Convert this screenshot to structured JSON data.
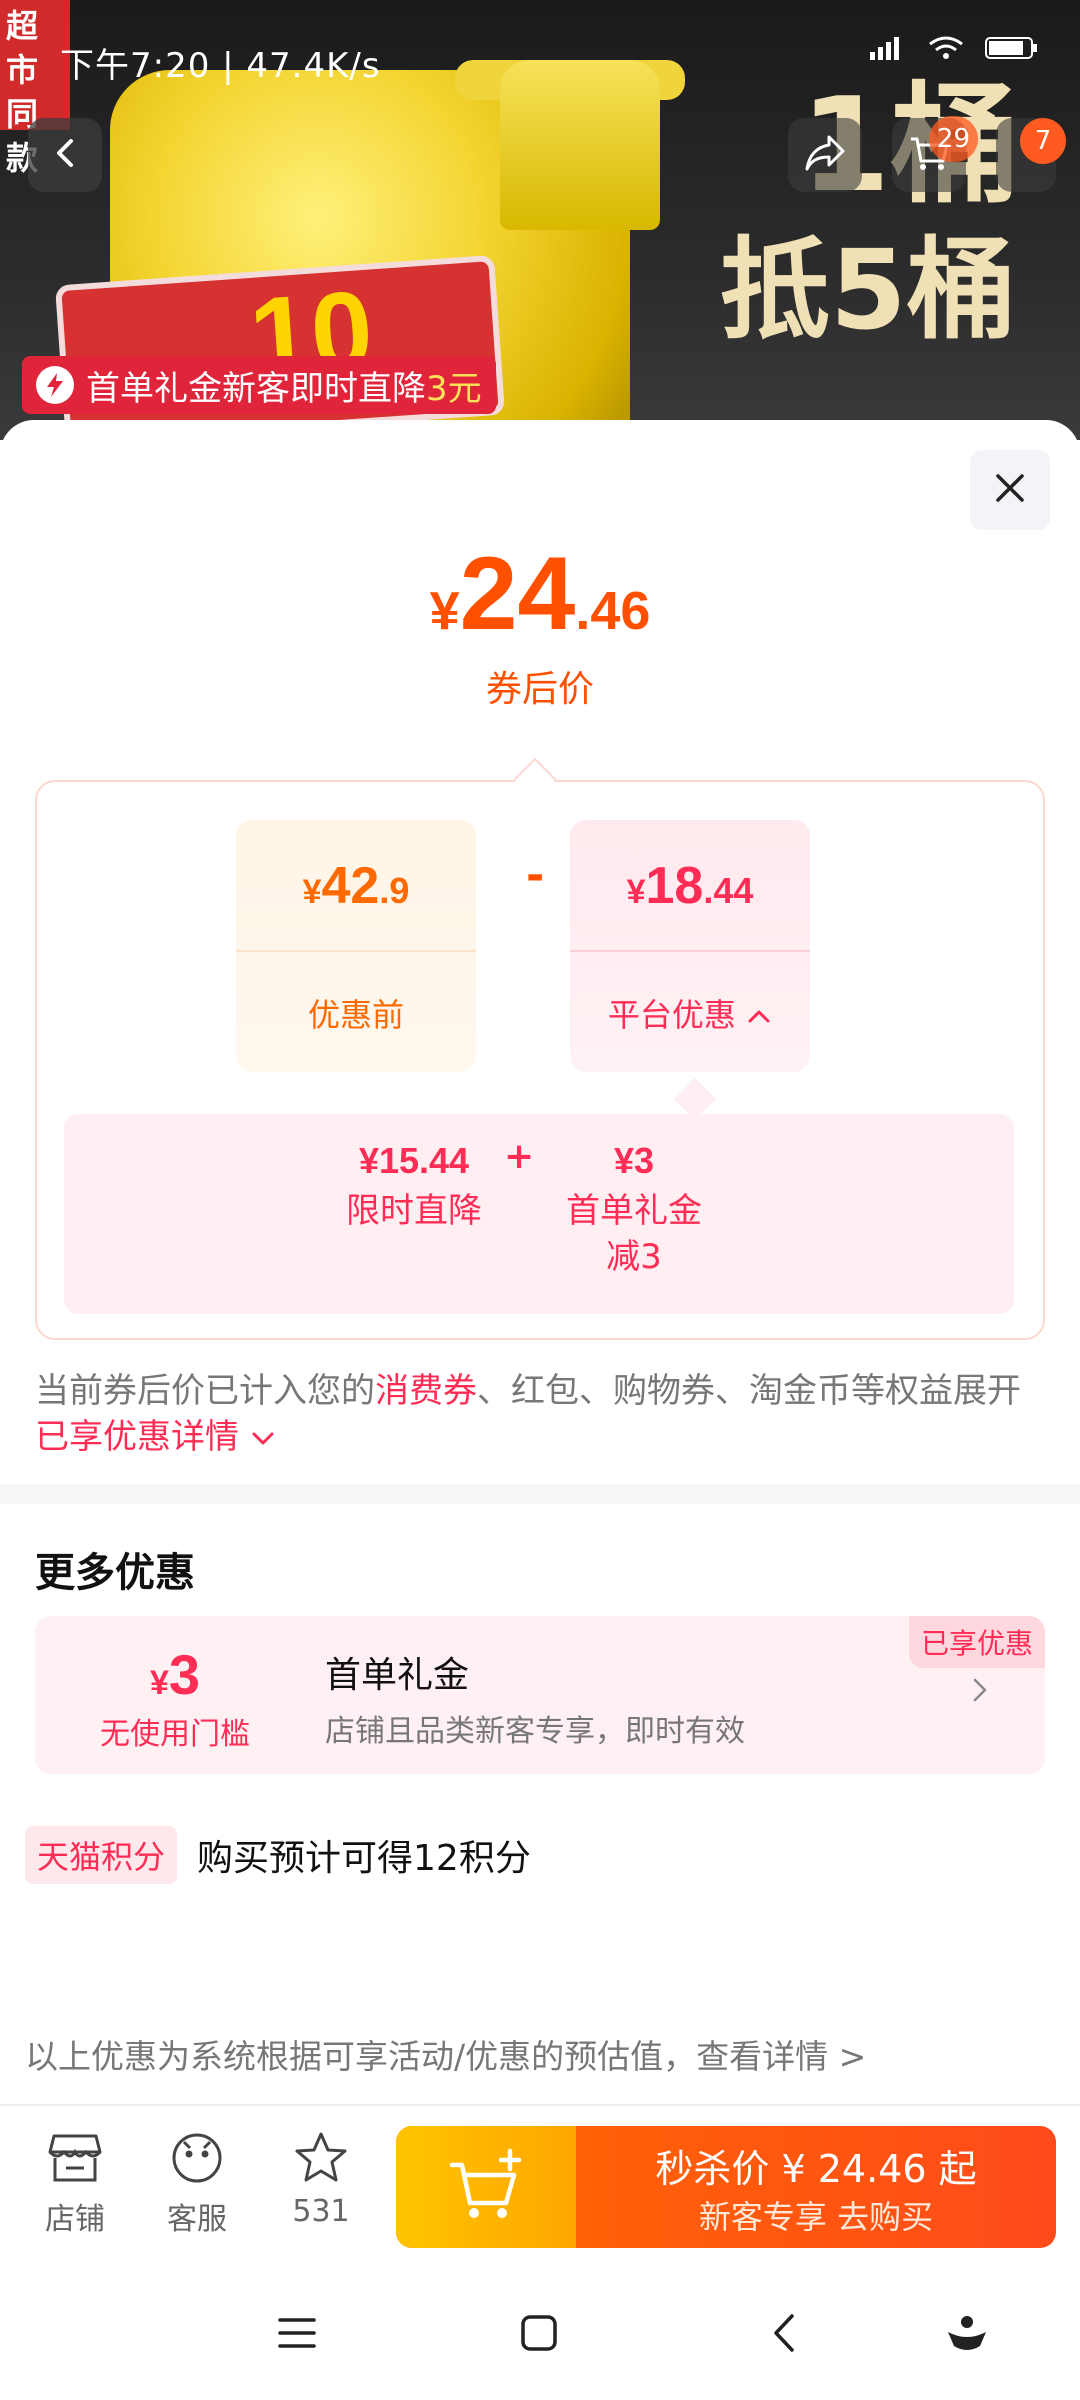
{
  "status_bar": {
    "time_speed": "下午7:20 | 47.4K/s"
  },
  "hero": {
    "supermarket_badge": "超市同款",
    "headline_1": "1桶",
    "headline_2": "抵5桶",
    "label_number": "10",
    "cart_count": "29",
    "more_count": "7",
    "first_order_banner": {
      "prefix": "首单礼金新客即时直降",
      "amount": "3元"
    }
  },
  "price": {
    "yen": "¥",
    "int": "24",
    "dec": ".46",
    "caption": "券后价"
  },
  "breakdown": {
    "before": {
      "yen": "¥",
      "int": "42",
      "dec": ".9",
      "label": "优惠前"
    },
    "operator": "-",
    "platform": {
      "yen": "¥",
      "int": "18",
      "dec": ".44",
      "label": "平台优惠"
    },
    "sub_items": [
      {
        "value": "¥15.44",
        "label": "限时直降"
      },
      {
        "value": "¥3",
        "label": "首单礼金",
        "label2": "减3"
      }
    ],
    "plus": "+"
  },
  "note": {
    "part1": "当前券后价已计入您的",
    "highlight1": "消费券",
    "part2": "、红包、购物券、淘金币等权益展开",
    "highlight2": "已享优惠详情"
  },
  "more": {
    "title": "更多优惠",
    "coupon": {
      "yen": "¥",
      "amount": "3",
      "threshold": "无使用门槛",
      "name": "首单礼金",
      "desc": "店铺且品类新客专享，即时有效",
      "tag": "已享优惠"
    }
  },
  "points": {
    "tag": "天猫积分",
    "text": "购买预计可得12积分"
  },
  "disclaimer": "以上优惠为系统根据可享活动/优惠的预估值，查看详情 >",
  "bottom": {
    "shop": "店铺",
    "service": "客服",
    "favorites": "531",
    "buy_line1": "秒杀价 ¥ 24.46 起",
    "buy_line2": "新客专享  去购买"
  },
  "colors": {
    "accent_orange": "#ff5000",
    "accent_red": "#ff2d55",
    "buy_gradient_start": "#ffc400"
  }
}
